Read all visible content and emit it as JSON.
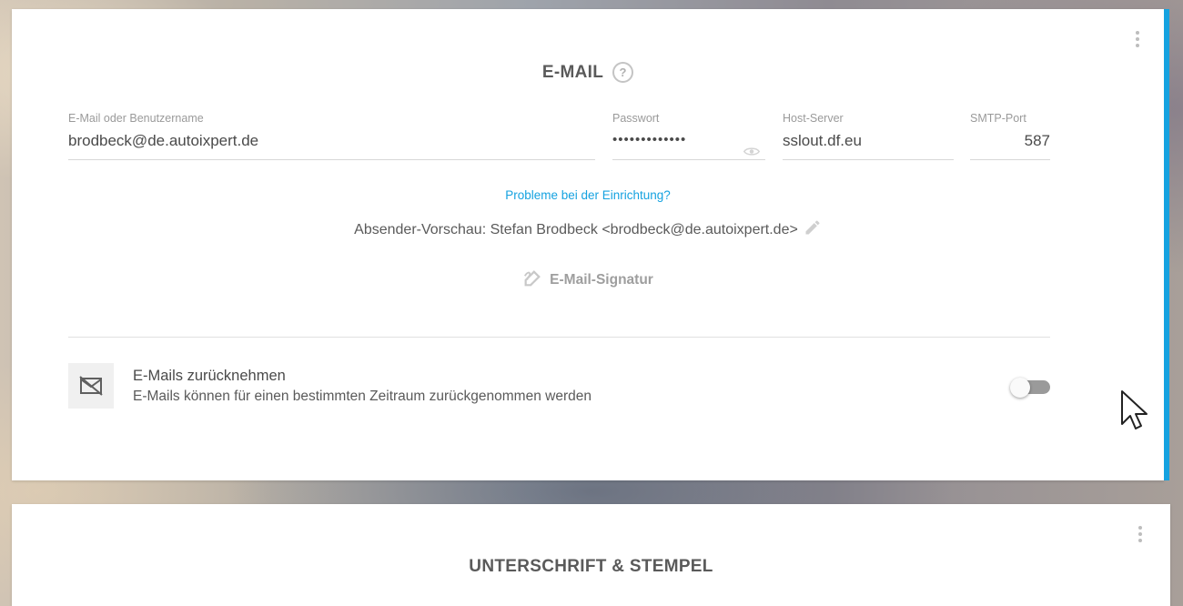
{
  "email_section": {
    "title": "E-MAIL",
    "help_icon": "?",
    "fields": {
      "email": {
        "label": "E-Mail oder Benutzername",
        "value": "brodbeck@de.autoixpert.de"
      },
      "password": {
        "label": "Passwort",
        "value": "•••••••••••••"
      },
      "host": {
        "label": "Host-Server",
        "value": "sslout.df.eu"
      },
      "port": {
        "label": "SMTP-Port",
        "value": "587"
      }
    },
    "setup_link": "Probleme bei der Einrichtung?",
    "sender_preview": "Absender-Vorschau: Stefan Brodbeck <brodbeck@de.autoixpert.de>",
    "signature_label": "E-Mail-Signatur",
    "recall": {
      "title": "E-Mails zurücknehmen",
      "subtitle": "E-Mails können für einen bestimmten Zeitraum zurückgenommen werden",
      "enabled": false
    }
  },
  "signature_section": {
    "title": "UNTERSCHRIFT & STEMPEL"
  },
  "colors": {
    "accent": "#15a2e0",
    "link": "#15a2e0",
    "toggle_off": "#9a9a9a"
  },
  "icons": [
    "help-icon",
    "eye-icon",
    "pencil-icon",
    "signature-icon",
    "mail-off-icon",
    "more-vert-icon",
    "mouse-cursor-icon"
  ]
}
